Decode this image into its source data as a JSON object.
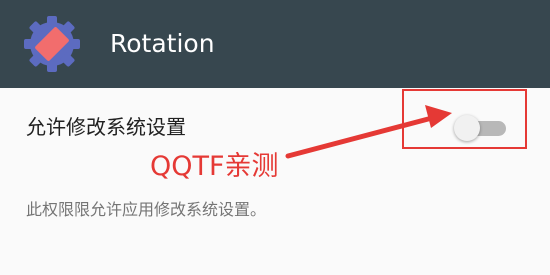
{
  "app_bar": {
    "title": "Rotation",
    "icon": "rotation-app-icon",
    "background_color": "#37474f"
  },
  "setting": {
    "title": "允许修改系统设置",
    "summary": "此权限限允许应用修改系统设置。",
    "toggle_state": "off"
  },
  "annotation": {
    "text": "QQTF亲测",
    "color": "#e53935"
  }
}
